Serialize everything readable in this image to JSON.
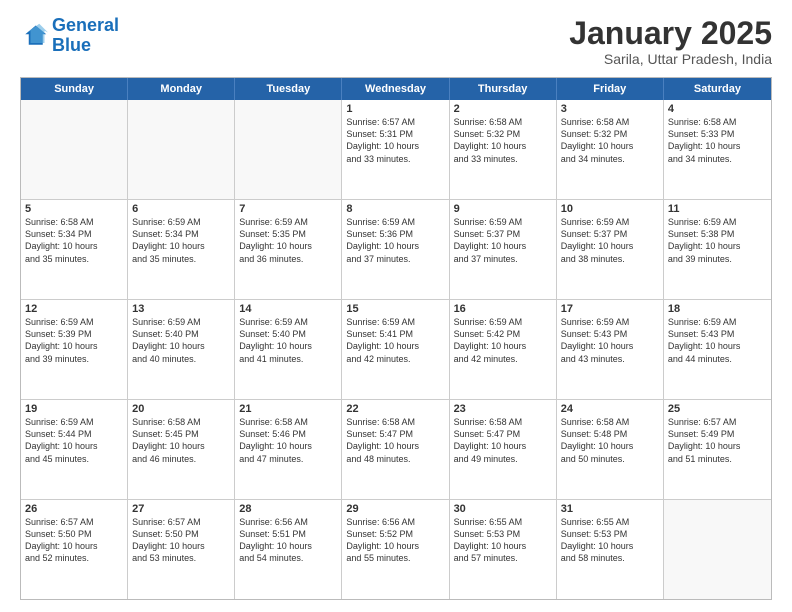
{
  "logo": {
    "line1": "General",
    "line2": "Blue"
  },
  "title": "January 2025",
  "subtitle": "Sarila, Uttar Pradesh, India",
  "days": [
    "Sunday",
    "Monday",
    "Tuesday",
    "Wednesday",
    "Thursday",
    "Friday",
    "Saturday"
  ],
  "rows": [
    [
      {
        "day": "",
        "lines": []
      },
      {
        "day": "",
        "lines": []
      },
      {
        "day": "",
        "lines": []
      },
      {
        "day": "1",
        "lines": [
          "Sunrise: 6:57 AM",
          "Sunset: 5:31 PM",
          "Daylight: 10 hours",
          "and 33 minutes."
        ]
      },
      {
        "day": "2",
        "lines": [
          "Sunrise: 6:58 AM",
          "Sunset: 5:32 PM",
          "Daylight: 10 hours",
          "and 33 minutes."
        ]
      },
      {
        "day": "3",
        "lines": [
          "Sunrise: 6:58 AM",
          "Sunset: 5:32 PM",
          "Daylight: 10 hours",
          "and 34 minutes."
        ]
      },
      {
        "day": "4",
        "lines": [
          "Sunrise: 6:58 AM",
          "Sunset: 5:33 PM",
          "Daylight: 10 hours",
          "and 34 minutes."
        ]
      }
    ],
    [
      {
        "day": "5",
        "lines": [
          "Sunrise: 6:58 AM",
          "Sunset: 5:34 PM",
          "Daylight: 10 hours",
          "and 35 minutes."
        ]
      },
      {
        "day": "6",
        "lines": [
          "Sunrise: 6:59 AM",
          "Sunset: 5:34 PM",
          "Daylight: 10 hours",
          "and 35 minutes."
        ]
      },
      {
        "day": "7",
        "lines": [
          "Sunrise: 6:59 AM",
          "Sunset: 5:35 PM",
          "Daylight: 10 hours",
          "and 36 minutes."
        ]
      },
      {
        "day": "8",
        "lines": [
          "Sunrise: 6:59 AM",
          "Sunset: 5:36 PM",
          "Daylight: 10 hours",
          "and 37 minutes."
        ]
      },
      {
        "day": "9",
        "lines": [
          "Sunrise: 6:59 AM",
          "Sunset: 5:37 PM",
          "Daylight: 10 hours",
          "and 37 minutes."
        ]
      },
      {
        "day": "10",
        "lines": [
          "Sunrise: 6:59 AM",
          "Sunset: 5:37 PM",
          "Daylight: 10 hours",
          "and 38 minutes."
        ]
      },
      {
        "day": "11",
        "lines": [
          "Sunrise: 6:59 AM",
          "Sunset: 5:38 PM",
          "Daylight: 10 hours",
          "and 39 minutes."
        ]
      }
    ],
    [
      {
        "day": "12",
        "lines": [
          "Sunrise: 6:59 AM",
          "Sunset: 5:39 PM",
          "Daylight: 10 hours",
          "and 39 minutes."
        ]
      },
      {
        "day": "13",
        "lines": [
          "Sunrise: 6:59 AM",
          "Sunset: 5:40 PM",
          "Daylight: 10 hours",
          "and 40 minutes."
        ]
      },
      {
        "day": "14",
        "lines": [
          "Sunrise: 6:59 AM",
          "Sunset: 5:40 PM",
          "Daylight: 10 hours",
          "and 41 minutes."
        ]
      },
      {
        "day": "15",
        "lines": [
          "Sunrise: 6:59 AM",
          "Sunset: 5:41 PM",
          "Daylight: 10 hours",
          "and 42 minutes."
        ]
      },
      {
        "day": "16",
        "lines": [
          "Sunrise: 6:59 AM",
          "Sunset: 5:42 PM",
          "Daylight: 10 hours",
          "and 42 minutes."
        ]
      },
      {
        "day": "17",
        "lines": [
          "Sunrise: 6:59 AM",
          "Sunset: 5:43 PM",
          "Daylight: 10 hours",
          "and 43 minutes."
        ]
      },
      {
        "day": "18",
        "lines": [
          "Sunrise: 6:59 AM",
          "Sunset: 5:43 PM",
          "Daylight: 10 hours",
          "and 44 minutes."
        ]
      }
    ],
    [
      {
        "day": "19",
        "lines": [
          "Sunrise: 6:59 AM",
          "Sunset: 5:44 PM",
          "Daylight: 10 hours",
          "and 45 minutes."
        ]
      },
      {
        "day": "20",
        "lines": [
          "Sunrise: 6:58 AM",
          "Sunset: 5:45 PM",
          "Daylight: 10 hours",
          "and 46 minutes."
        ]
      },
      {
        "day": "21",
        "lines": [
          "Sunrise: 6:58 AM",
          "Sunset: 5:46 PM",
          "Daylight: 10 hours",
          "and 47 minutes."
        ]
      },
      {
        "day": "22",
        "lines": [
          "Sunrise: 6:58 AM",
          "Sunset: 5:47 PM",
          "Daylight: 10 hours",
          "and 48 minutes."
        ]
      },
      {
        "day": "23",
        "lines": [
          "Sunrise: 6:58 AM",
          "Sunset: 5:47 PM",
          "Daylight: 10 hours",
          "and 49 minutes."
        ]
      },
      {
        "day": "24",
        "lines": [
          "Sunrise: 6:58 AM",
          "Sunset: 5:48 PM",
          "Daylight: 10 hours",
          "and 50 minutes."
        ]
      },
      {
        "day": "25",
        "lines": [
          "Sunrise: 6:57 AM",
          "Sunset: 5:49 PM",
          "Daylight: 10 hours",
          "and 51 minutes."
        ]
      }
    ],
    [
      {
        "day": "26",
        "lines": [
          "Sunrise: 6:57 AM",
          "Sunset: 5:50 PM",
          "Daylight: 10 hours",
          "and 52 minutes."
        ]
      },
      {
        "day": "27",
        "lines": [
          "Sunrise: 6:57 AM",
          "Sunset: 5:50 PM",
          "Daylight: 10 hours",
          "and 53 minutes."
        ]
      },
      {
        "day": "28",
        "lines": [
          "Sunrise: 6:56 AM",
          "Sunset: 5:51 PM",
          "Daylight: 10 hours",
          "and 54 minutes."
        ]
      },
      {
        "day": "29",
        "lines": [
          "Sunrise: 6:56 AM",
          "Sunset: 5:52 PM",
          "Daylight: 10 hours",
          "and 55 minutes."
        ]
      },
      {
        "day": "30",
        "lines": [
          "Sunrise: 6:55 AM",
          "Sunset: 5:53 PM",
          "Daylight: 10 hours",
          "and 57 minutes."
        ]
      },
      {
        "day": "31",
        "lines": [
          "Sunrise: 6:55 AM",
          "Sunset: 5:53 PM",
          "Daylight: 10 hours",
          "and 58 minutes."
        ]
      },
      {
        "day": "",
        "lines": []
      }
    ]
  ]
}
